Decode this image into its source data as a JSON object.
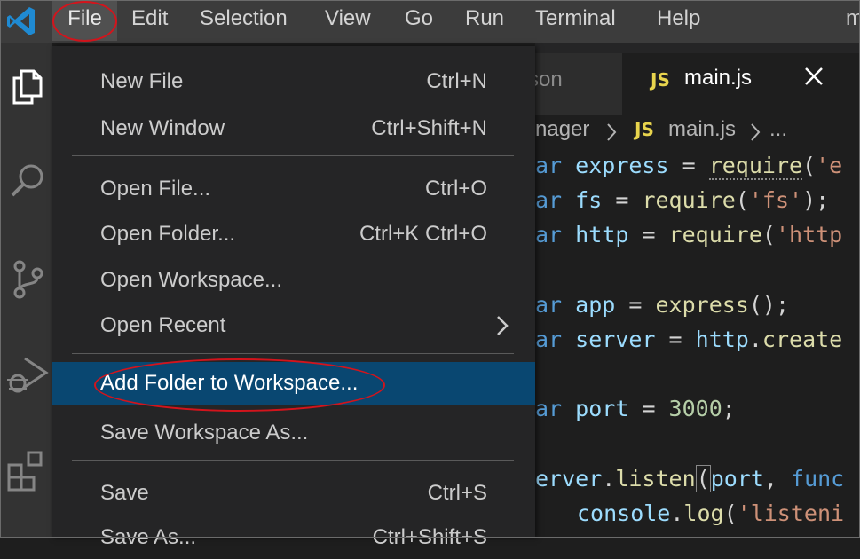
{
  "menubar": {
    "items": [
      "File",
      "Edit",
      "Selection",
      "View",
      "Go",
      "Run",
      "Terminal",
      "Help"
    ],
    "title_fragment": "m"
  },
  "activitybar": {
    "icons": [
      "explorer-icon",
      "search-icon",
      "source-control-icon",
      "run-debug-icon",
      "extensions-icon"
    ]
  },
  "tabs": {
    "inactive": {
      "label": "son"
    },
    "active": {
      "badge": "JS",
      "label": "main.js"
    }
  },
  "breadcrumb": {
    "folder": "nager",
    "badge": "JS",
    "file": "main.js",
    "more": "..."
  },
  "file_menu": {
    "items": [
      {
        "label": "New File",
        "shortcut": "Ctrl+N"
      },
      {
        "label": "New Window",
        "shortcut": "Ctrl+Shift+N"
      },
      {
        "label": "Open File...",
        "shortcut": "Ctrl+O"
      },
      {
        "label": "Open Folder...",
        "shortcut": "Ctrl+K Ctrl+O"
      },
      {
        "label": "Open Workspace...",
        "shortcut": ""
      },
      {
        "label": "Open Recent",
        "shortcut": ""
      },
      {
        "label": "Add Folder to Workspace...",
        "shortcut": ""
      },
      {
        "label": "Save Workspace As...",
        "shortcut": ""
      },
      {
        "label": "Save",
        "shortcut": "Ctrl+S"
      },
      {
        "label": "Save As...",
        "shortcut": "Ctrl+Shift+S"
      }
    ]
  },
  "code": {
    "l1": {
      "kw": "ar",
      "name": "express",
      "eq": " = ",
      "fn": "require",
      "op": "(",
      "str": "'e"
    },
    "l2": {
      "kw": "ar",
      "name": "fs",
      "eq": " = ",
      "fn": "require",
      "op": "(",
      "str": "'fs'",
      "end": ");"
    },
    "l3": {
      "kw": "ar",
      "name": "http",
      "eq": " = ",
      "fn": "require",
      "op": "(",
      "str": "'http"
    },
    "l4": {
      "kw": "ar",
      "name": "app",
      "eq": " = ",
      "fn": "express",
      "end": "();"
    },
    "l5": {
      "kw": "ar",
      "name": "server",
      "eq": " = ",
      "obj": "http",
      "dot": ".",
      "fn": "create"
    },
    "l6": {
      "kw": "ar",
      "name": "port",
      "eq": " = ",
      "num": "3000",
      "end": ";"
    },
    "l7": {
      "obj": "erver",
      "dot": ".",
      "fn": "listen",
      "op": "(",
      "arg": "port",
      "comma": ", ",
      "kw": "func"
    },
    "l8": {
      "obj": "console",
      "dot": ".",
      "fn": "log",
      "op": "(",
      "str": "'listeni"
    }
  }
}
